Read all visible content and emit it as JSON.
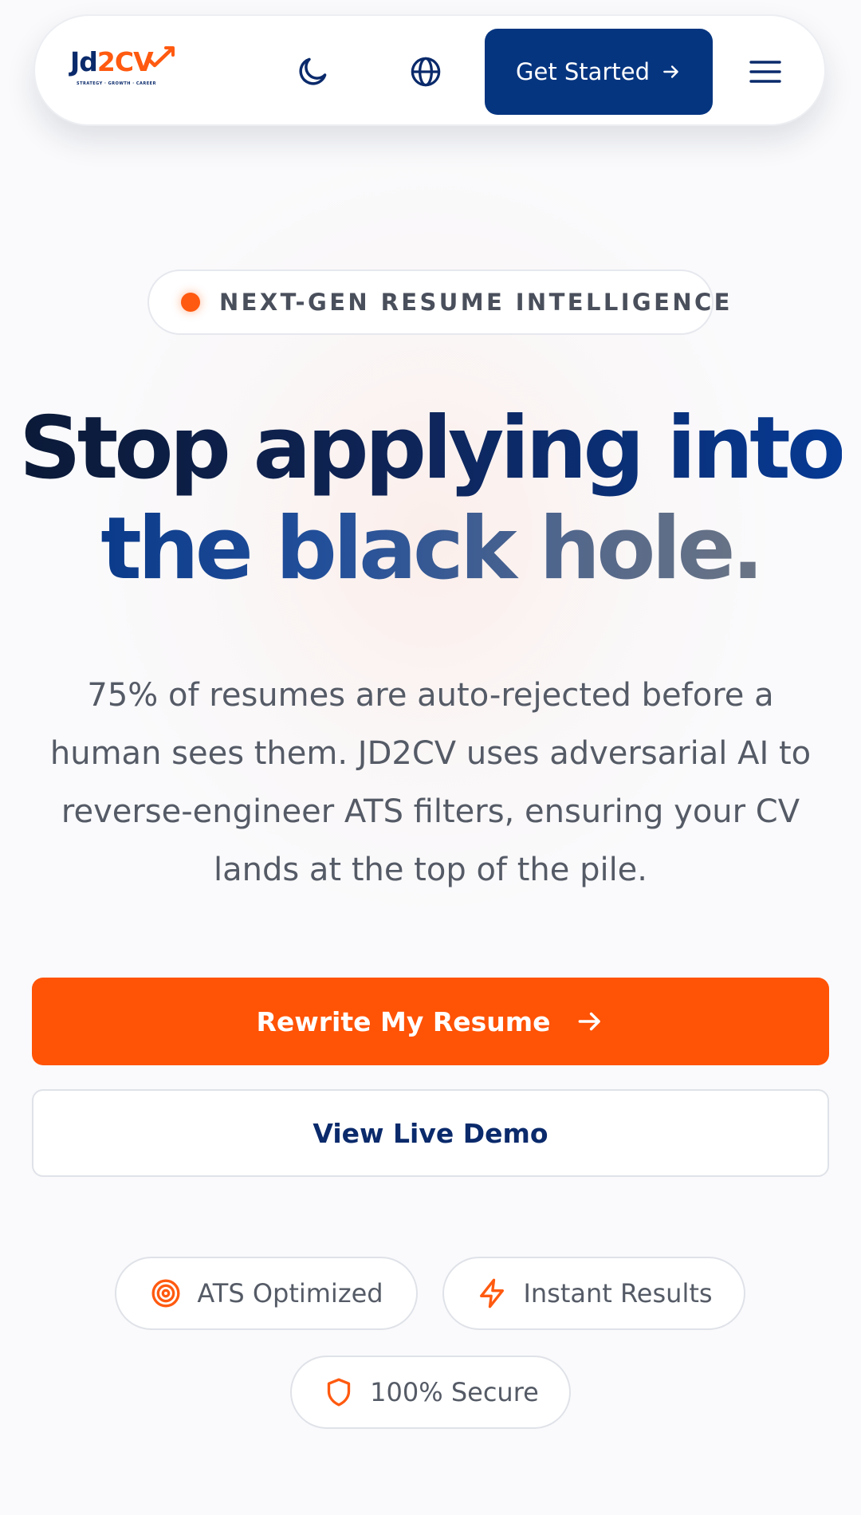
{
  "brand": {
    "logo_text_jd": "Jd",
    "logo_text_2": "2",
    "logo_text_cv": "CV",
    "logo_tagline": "STRATEGY · GROWTH · CAREER",
    "primary_color": "#063580",
    "accent_color": "#ff5306"
  },
  "nav": {
    "theme_icon": "moon-icon",
    "language_icon": "globe-icon",
    "cta_label": "Get Started",
    "cta_icon": "arrow-right-icon",
    "menu_icon": "hamburger-menu-icon"
  },
  "hero": {
    "badge_text": "NEXT-GEN RESUME INTELLIGENCE",
    "headline_line1": "Stop applying into",
    "headline_line2": "the black hole.",
    "subtext": "75% of resumes are auto-rejected before a human sees them. JD2CV uses adversarial AI to reverse-engineer ATS filters, ensuring your CV lands at the top of the pile.",
    "primary_button": "Rewrite My Resume",
    "primary_button_icon": "arrow-right-icon",
    "secondary_button": "View Live Demo"
  },
  "features": [
    {
      "label": "ATS Optimized",
      "icon": "target-icon"
    },
    {
      "label": "Instant Results",
      "icon": "lightning-icon"
    },
    {
      "label": "100% Secure",
      "icon": "shield-icon"
    }
  ]
}
